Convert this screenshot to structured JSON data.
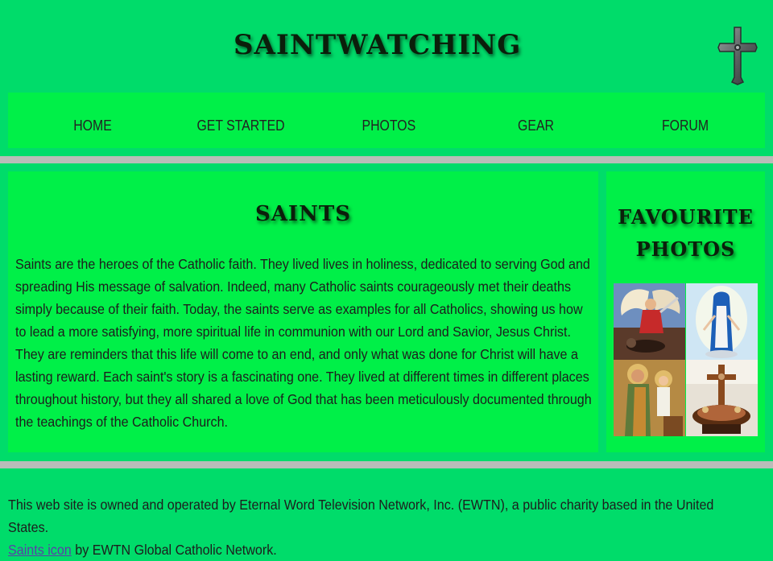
{
  "site": {
    "title": "SAINTWATCHING"
  },
  "nav": {
    "items": [
      {
        "label": "HOME"
      },
      {
        "label": "GET STARTED"
      },
      {
        "label": "PHOTOS"
      },
      {
        "label": "GEAR"
      },
      {
        "label": "FORUM"
      }
    ]
  },
  "main": {
    "heading": "SAINTS",
    "paragraph": "Saints are the heroes of the Catholic faith. They lived lives in holiness, dedicated to serving God and spreading His message of salvation. Indeed, many Catholic saints courageously met their deaths simply because of their faith. Today, the saints serve as examples for all Catholics, showing us how to lead a more satisfying, more spiritual life in communion with our Lord and Savior, Jesus Christ. They are reminders that this life will come to an end, and only what was done for Christ will have a lasting reward. Each saint's story is a fascinating one. They lived at different times in different places throughout history, but they all shared a love of God that has been meticulously documented through the teachings of the Catholic Church."
  },
  "sidebar": {
    "heading_line1": "FAVOURITE",
    "heading_line2": "PHOTOS"
  },
  "footer": {
    "line1": "This web site is owned and operated by Eternal Word Television Network, Inc. (EWTN), a public charity based in the United States.",
    "link_text": "Saints icon",
    "line2_suffix": " by EWTN Global Catholic Network."
  },
  "colors": {
    "page_background": "#00dc6a",
    "panel_background": "#00f048",
    "divider": "#b9bdb9",
    "link": "#5a3fa8"
  }
}
